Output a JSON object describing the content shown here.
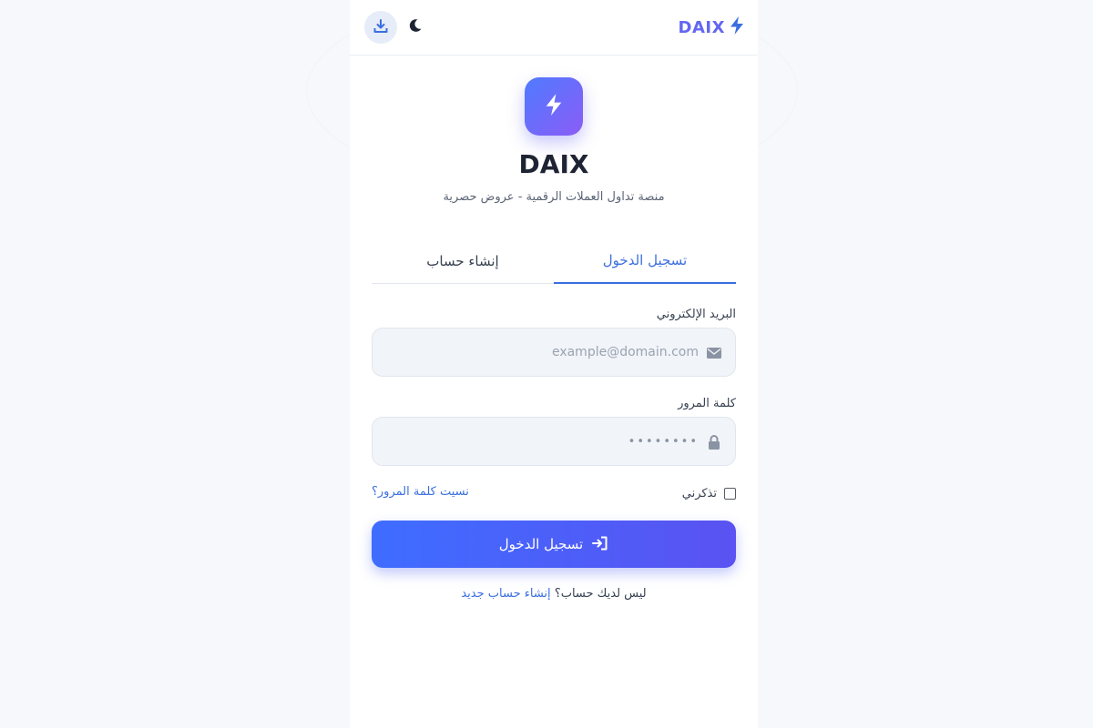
{
  "header": {
    "brand": "DAIX",
    "download_icon": "download-icon",
    "theme_icon": "moon-icon",
    "brand_icon": "bolt-icon"
  },
  "hero": {
    "title": "DAIX",
    "subtitle": "منصة تداول العملات الرقمية - عروض حصرية",
    "logo_icon": "bolt-icon"
  },
  "tabs": [
    {
      "label": "تسجيل الدخول",
      "active": true
    },
    {
      "label": "إنشاء حساب",
      "active": false
    }
  ],
  "form": {
    "email": {
      "label": "البريد الإلكتروني",
      "placeholder": "example@domain.com",
      "icon": "envelope-icon"
    },
    "password": {
      "label": "كلمة المرور",
      "placeholder": "••••••••",
      "icon": "lock-icon"
    },
    "remember_label": "تذكرني",
    "remember_checked": false,
    "forgot_label": "نسيت كلمة المرور؟",
    "submit_label": "تسجيل الدخول",
    "submit_icon": "sign-in-icon"
  },
  "footer": {
    "prompt": "ليس لديك حساب؟",
    "link": "إنشاء حساب جديد"
  },
  "colors": {
    "accent": "#3b6fe0",
    "brand": "#6366f1",
    "gradient_start": "#4f7bff",
    "gradient_end": "#8b5cf6"
  }
}
